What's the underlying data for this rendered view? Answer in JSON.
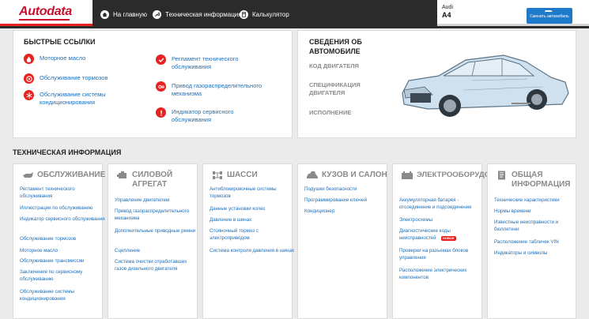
{
  "header": {
    "logo": "Autodata",
    "nav": [
      {
        "label": "На главную",
        "icon": "home-icon"
      },
      {
        "label": "Техническая информация",
        "icon": "wrench-icon"
      },
      {
        "label": "Калькулятор",
        "icon": "calculator-icon"
      }
    ],
    "vehicle": {
      "make": "Audi",
      "model": "A4"
    },
    "change_vehicle_label": "Сменить автомобиль"
  },
  "quick_links": {
    "title": "БЫСТРЫЕ ССЫЛКИ",
    "items": [
      {
        "label": "Моторное масло",
        "icon": "oil-drop-icon"
      },
      {
        "label": "Обслуживание тормозов",
        "icon": "brake-disc-icon"
      },
      {
        "label": "Обслуживание системы кондиционирования",
        "icon": "snowflake-icon"
      },
      {
        "label": "Регламент технического обслуживания",
        "icon": "checkmark-icon"
      },
      {
        "label": "Привод газораспределительного механизма",
        "icon": "timing-belt-icon"
      },
      {
        "label": "Индикатор сервисного обслуживания",
        "icon": "warning-icon"
      }
    ]
  },
  "car_info": {
    "title": "СВЕДЕНИЯ ОБ АВТОМОБИЛЕ",
    "engine_code_label": "КОД ДВИГАТЕЛЯ",
    "engine_spec_label": "СПЕЦИФИКАЦИЯ ДВИГАТЕЛЯ",
    "version_label": "ИСПОЛНЕНИЕ"
  },
  "tech_info": {
    "title": "ТЕХНИЧЕСКАЯ ИНФОРМАЦИЯ",
    "categories": [
      {
        "title": "ОБСЛУЖИВАНИЕ",
        "icon": "oil-can-icon",
        "links": [
          "Регламент технического обслуживания",
          "Иллюстрации по обслуживанию",
          "Индикатор сервисного обслуживания",
          "Обслуживание тормозов",
          "Моторное масло",
          "Обслуживание трансмиссии",
          "Заключение по сервисному обслуживанию",
          "Обслуживание системы кондиционирования"
        ]
      },
      {
        "title": "СИЛОВОЙ АГРЕГАТ",
        "icon": "engine-icon",
        "links": [
          "Управление двигателем",
          "Привод газораспределительного механизма",
          "Дополнительные приводные ремни",
          "Сцепление",
          "Система очистки отработавших газов дизельного двигателя"
        ]
      },
      {
        "title": "ШАССИ",
        "icon": "chassis-icon",
        "links": [
          "Антиблокировочные системы тормозов",
          "Данные установки колес",
          "Давление в шинах",
          "Стояночный тормоз с электроприводом",
          "Система контроля давления в шинах"
        ]
      },
      {
        "title": "КУЗОВ И САЛОН",
        "icon": "car-body-icon",
        "links": [
          "Подушки безопасности",
          "Программирование ключей",
          "Кондиционер"
        ]
      },
      {
        "title": "ЭЛЕКТРООБОРУДОВАНИЕ",
        "icon": "battery-icon",
        "links": [
          "Аккумуляторная батарея - отсоединение и подсоединение",
          "Электросхемы",
          "Диагностические коды неисправностей",
          "Проверки на разъемах блоков управления",
          "Расположение электрических компонентов"
        ],
        "badge": "НОВОЕ"
      },
      {
        "title": "ОБЩАЯ ИНФОРМАЦИЯ",
        "icon": "document-icon",
        "links": [
          "Технические характеристики",
          "Нормы времени",
          "Известные неисправности и бюллетени",
          "Расположение табличек VIN",
          "Индикаторы и символы"
        ]
      }
    ]
  },
  "colors": {
    "accent_red": "#e8231f",
    "link_blue": "#1e6fb8",
    "topbar": "#2b2b2b",
    "button_blue": "#1f7acb"
  }
}
